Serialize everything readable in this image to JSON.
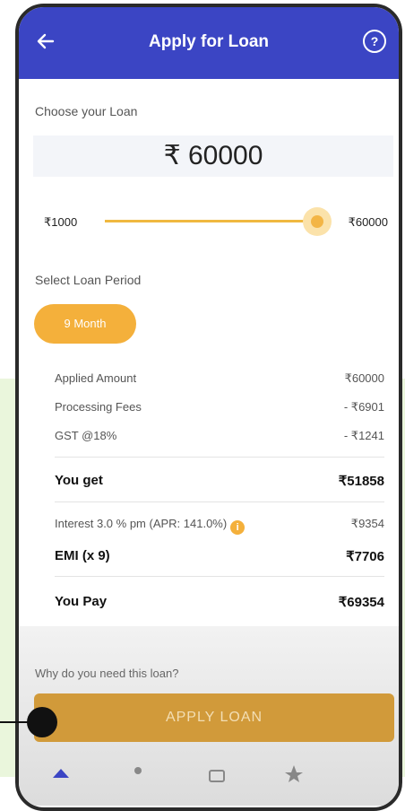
{
  "header": {
    "title": "Apply for Loan",
    "help": "?"
  },
  "loan": {
    "choose_label": "Choose your Loan",
    "amount": "₹ 60000",
    "slider_min": "₹1000",
    "slider_max": "₹60000",
    "slider_fraction": 1.0,
    "period_label": "Select Loan Period",
    "period_option": "9 Month"
  },
  "summary": {
    "applied_label": "Applied Amount",
    "applied_value": "₹60000",
    "fees_label": "Processing Fees",
    "fees_value": "- ₹6901",
    "gst_label": "GST @18%",
    "gst_value": "- ₹1241",
    "you_get_label": "You get",
    "you_get_value": "₹51858",
    "interest_label": "Interest 3.0 % pm (APR: 141.0%)",
    "interest_value": "₹9354",
    "info_icon": "i",
    "emi_label": "EMI  (x 9)",
    "emi_value": "₹7706",
    "you_pay_label": "You Pay",
    "you_pay_value": "₹69354"
  },
  "footer": {
    "why_label": "Why do you need this loan?",
    "apply_label": "APPLY LOAN"
  },
  "colors": {
    "header": "#3b45c4",
    "accent": "#f4b03b",
    "button": "#d19a3a"
  }
}
